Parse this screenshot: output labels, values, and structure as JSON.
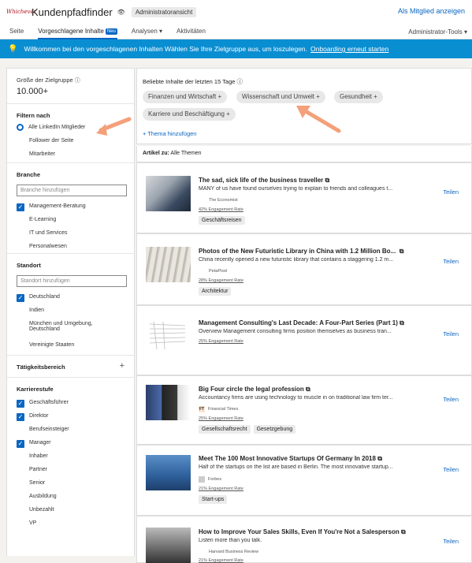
{
  "header": {
    "logo_text": "Whichever",
    "app_name": "Kundenpfadfinder",
    "admin_badge": "Administratoransicht",
    "member_link": "Als Mitglied anzeigen"
  },
  "nav": {
    "tabs": [
      "Seite",
      "Vorgeschlagene Inhalte",
      "Analysen",
      "Aktivitäten"
    ],
    "new_badge": "Neu",
    "admin_tools": "Administrator-Tools"
  },
  "banner": {
    "text": "Willkommen bei den vorgeschlagenen Inhalten Wählen Sie Ihre Zielgruppe aus, um loszulegen.",
    "link": "Onboarding erneut starten"
  },
  "sidebar": {
    "audience_label": "Größe der Zielgruppe",
    "audience_value": "10.000+",
    "filter_label": "Filtern nach",
    "filter_options": [
      "Alle LinkedIn Mitglieder",
      "Follower der Seite",
      "Mitarbeiter"
    ],
    "branche_label": "Branche",
    "branche_placeholder": "Branche hinzufügen",
    "branche_items": [
      "Management-Beratung",
      "E-Learning",
      "IT und Services",
      "Personalwesen"
    ],
    "standort_label": "Standort",
    "standort_placeholder": "Standort hinzufügen",
    "standort_items": [
      "Deutschland",
      "Indien",
      "München und Umgebung, Deutschland",
      "Vereinigte Staaten"
    ],
    "taetigkeit_label": "Tätigkeitsbereich",
    "karriere_label": "Karrierestufe",
    "karriere_items": [
      "Geschäftsführer",
      "Direktor",
      "Berufseinsteiger",
      "Manager",
      "Inhaber",
      "Partner",
      "Senior",
      "Ausbildung",
      "Unbezahlt",
      "VP"
    ]
  },
  "popular": {
    "label": "Beliebte Inhalte der letzten 15 Tage",
    "topics": [
      "Finanzen und Wirtschaft +",
      "Wissenschaft und Umwelt +",
      "Gesundheit +",
      "Karriere und Beschäftigung +"
    ],
    "add_topic": "+ Thema hinzufügen"
  },
  "articles_for": {
    "label": "Artikel zu:",
    "value": "Alle Themen"
  },
  "share_label": "Teilen",
  "articles": [
    {
      "title": "The sad, sick life of the business traveller",
      "desc": "MANY of us have found ourselves trying to explain to friends and colleagues t...",
      "source": "The Economist",
      "engagement": "42% Engagement Rate",
      "tags": [
        "Geschäftsreisen"
      ]
    },
    {
      "title": "Photos of the New Futuristic Library in China with 1.2 Million Bo...",
      "desc": "China recently opened a new futuristic library that contains a staggering 1.2 m...",
      "source": "PetaPixel",
      "engagement": "28% Engagement Rate",
      "tags": [
        "Architektur"
      ]
    },
    {
      "title": "Management Consulting's Last Decade: A Four-Part Series (Part 1)",
      "desc": "Overview Management consulting firms position themselves as business tran...",
      "source": "",
      "engagement": "25% Engagement Rate",
      "tags": []
    },
    {
      "title": "Big Four circle the legal profession",
      "desc": "Accountancy firms are using technology to muscle in on traditional law firm ter...",
      "source": "Financial Times",
      "engagement": "25% Engagement Rate",
      "tags": [
        "Gesellschaftsrecht",
        "Gesetzgebung"
      ]
    },
    {
      "title": "Meet The 100 Most Innovative Startups Of Germany In 2018",
      "desc": "Half of the startups on the list are based in Berlin. The most innovative startup...",
      "source": "Forbes",
      "engagement": "21% Engagement Rate",
      "tags": [
        "Start-ups"
      ]
    },
    {
      "title": "How to Improve Your Sales Skills, Even If You're Not a Salesperson",
      "desc": "Listen more than you talk.",
      "source": "Harvard Business Review",
      "engagement": "21% Engagement Rate",
      "tags": []
    }
  ],
  "colors": {
    "accent": "#0a66c2",
    "banner": "#0a8ed2",
    "arrow": "#f4a07a"
  }
}
